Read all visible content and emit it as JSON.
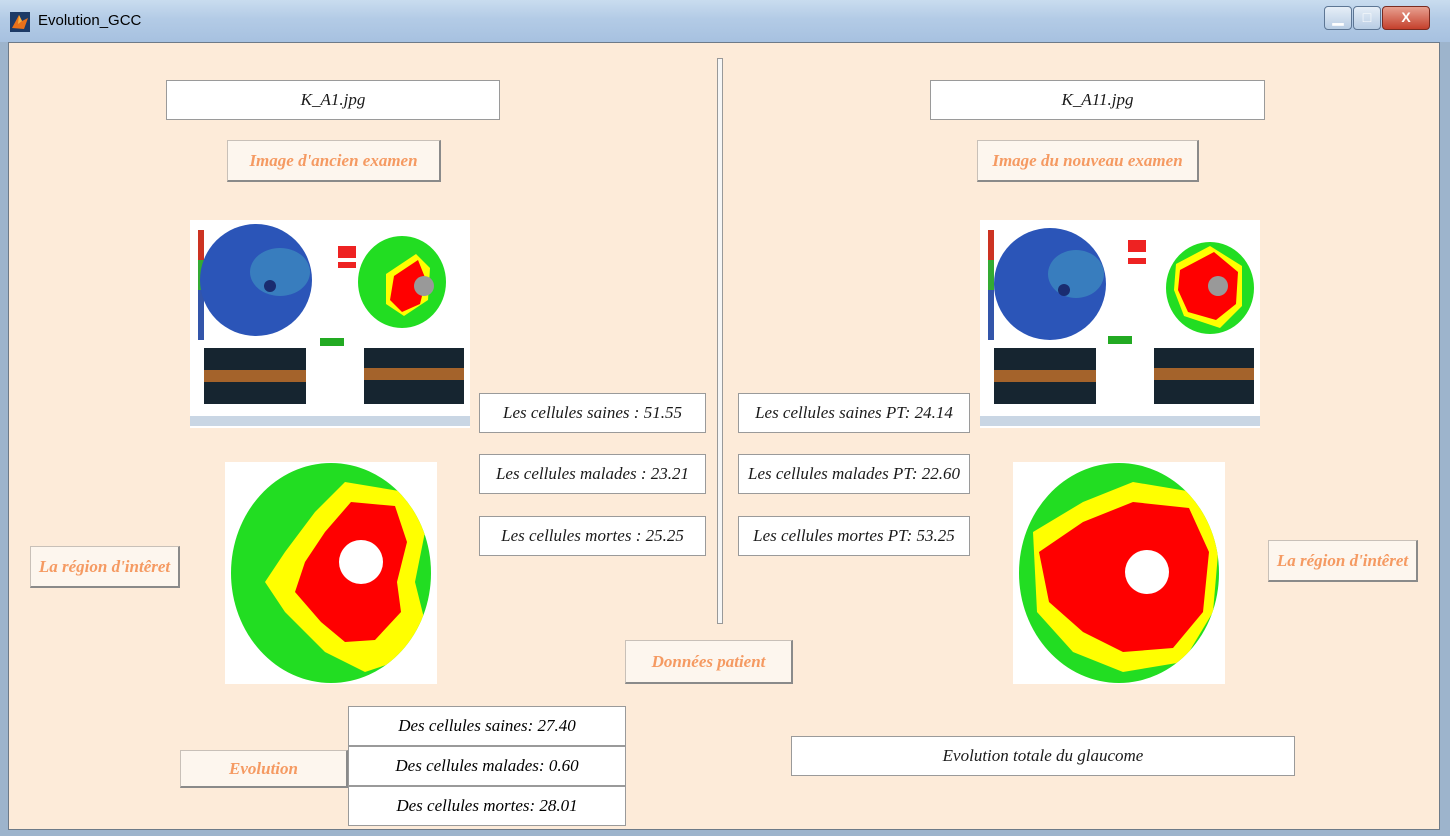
{
  "window": {
    "title": "Evolution_GCC",
    "minimize_glyph": "▁",
    "maximize_glyph": "□",
    "close_glyph": "X"
  },
  "left": {
    "filename": "K_A1.jpg",
    "image_button": "Image d'ancien examen",
    "roi_button": "La région d'intêret",
    "stats": [
      "Les cellules saines : 51.55",
      "Les cellules malades : 23.21",
      "Les cellules mortes : 25.25"
    ]
  },
  "right": {
    "filename": "K_A11.jpg",
    "image_button": "Image du nouveau examen",
    "roi_button": "La région d'intêret",
    "stats": [
      "Les cellules saines PT: 24.14",
      "Les cellules malades PT: 22.60",
      "Les cellules mortes PT: 53.25"
    ]
  },
  "patient_button": "Données patient",
  "evolution": {
    "button": "Evolution",
    "values": [
      "Des cellules saines: 27.40",
      "Des cellules malades: 0.60",
      "Des cellules mortes: 28.01"
    ],
    "total_label": "Evolution totale du glaucome"
  },
  "colors": {
    "healthy": "#22dd22",
    "sick": "#ffff00",
    "dead": "#ff0000",
    "button_text": "#f59a62",
    "panel_bg": "#fdebd9"
  }
}
